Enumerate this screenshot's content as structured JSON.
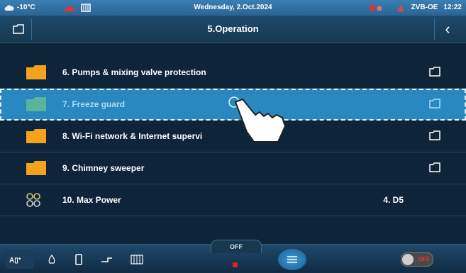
{
  "status": {
    "temperature": "-10°C",
    "date": "Wednesday, 2.Oct.2024",
    "device": "ZVB-OE",
    "time": "12:22"
  },
  "header": {
    "title": "5.Operation",
    "back_icon": "chevron-left-icon",
    "left_icon": "folder-icon"
  },
  "items": [
    {
      "label": "6.  Pumps & mixing valve protection",
      "icon": "folder-icon",
      "selected": false
    },
    {
      "label": "7.  Freeze guard",
      "icon": "folder-icon",
      "selected": true
    },
    {
      "label": "8.  Wi-Fi network & Internet supervi",
      "icon": "folder-icon",
      "selected": false
    },
    {
      "label": "9.  Chimney sweeper",
      "icon": "folder-icon",
      "selected": false
    },
    {
      "label": "10. Max Power",
      "icon": "dots-icon",
      "value": "4. D5",
      "selected": false
    }
  ],
  "bottom": {
    "off_label": "OFF",
    "toggle_label": "OFF"
  },
  "colors": {
    "background": "#0e2438",
    "selected_row": "#2a88c0",
    "folder": "#f3a31f",
    "folder_selected": "#58b49a"
  }
}
